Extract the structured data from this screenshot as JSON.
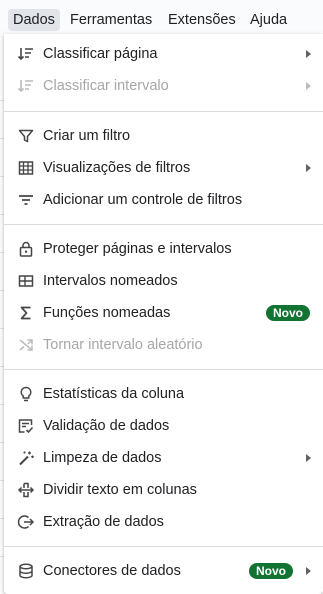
{
  "menubar": {
    "items": [
      {
        "label": "Dados"
      },
      {
        "label": "Ferramentas"
      },
      {
        "label": "Extensões"
      },
      {
        "label": "Ajuda"
      }
    ]
  },
  "menu": {
    "items": [
      {
        "label": "Classificar página",
        "icon": "sort-icon",
        "submenu": true,
        "disabled": false
      },
      {
        "label": "Classificar intervalo",
        "icon": "sort-range-icon",
        "submenu": true,
        "disabled": true
      },
      {
        "label": "Criar um filtro",
        "icon": "filter-icon",
        "submenu": false,
        "disabled": false
      },
      {
        "label": "Visualizações de filtros",
        "icon": "filter-views-icon",
        "submenu": true,
        "disabled": false
      },
      {
        "label": "Adicionar um controle de filtros",
        "icon": "filter-control-icon",
        "submenu": false,
        "disabled": false
      },
      {
        "label": "Proteger páginas e intervalos",
        "icon": "lock-icon",
        "submenu": false,
        "disabled": false
      },
      {
        "label": "Intervalos nomeados",
        "icon": "named-ranges-icon",
        "submenu": false,
        "disabled": false
      },
      {
        "label": "Funções nomeadas",
        "icon": "sigma-icon",
        "badge": "Novo",
        "submenu": false,
        "disabled": false
      },
      {
        "label": "Tornar intervalo aleatório",
        "icon": "shuffle-icon",
        "submenu": false,
        "disabled": true
      },
      {
        "label": "Estatísticas da coluna",
        "icon": "lightbulb-icon",
        "submenu": false,
        "disabled": false
      },
      {
        "label": "Validação de dados",
        "icon": "data-validation-icon",
        "submenu": false,
        "disabled": false
      },
      {
        "label": "Limpeza de dados",
        "icon": "magic-wand-icon",
        "submenu": true,
        "disabled": false
      },
      {
        "label": "Dividir texto em colunas",
        "icon": "split-columns-icon",
        "submenu": false,
        "disabled": false
      },
      {
        "label": "Extração de dados",
        "icon": "extract-icon",
        "submenu": false,
        "disabled": false
      },
      {
        "label": "Conectores de dados",
        "icon": "database-icon",
        "badge": "Novo",
        "submenu": true,
        "disabled": false
      }
    ]
  },
  "colors": {
    "badge_bg": "#137333",
    "disabled_text": "#a5a7aa",
    "menubar_bg": "#f9fbfd",
    "active_menu_bg": "#e1e5ea"
  }
}
